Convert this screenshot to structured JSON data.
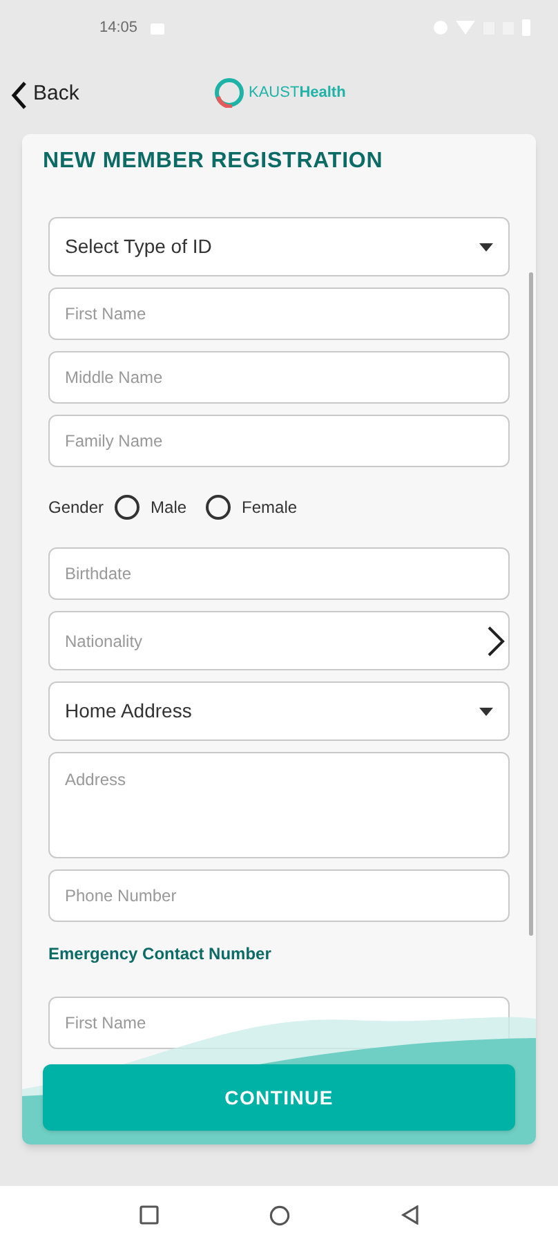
{
  "status_bar": {
    "time": "14:05"
  },
  "header": {
    "back": "Back",
    "logo": "KAUST**Health**"
  },
  "form": {
    "title": "NEW MEMBER REGISTRATION",
    "items": [
      {
        "kind": "select",
        "text": "Select Type of ID"
      },
      {
        "kind": "input",
        "placeholder": "First Name"
      },
      {
        "kind": "input",
        "placeholder": "Middle Name"
      },
      {
        "kind": "input",
        "placeholder": "Family Name"
      },
      {
        "kind": "radio",
        "label": "Gender",
        "options": [
          {
            "label": "Male",
            "selected": false
          },
          {
            "label": "Female",
            "selected": false
          }
        ]
      },
      {
        "kind": "input",
        "placeholder": "Birthdate"
      },
      {
        "kind": "link",
        "placeholder": "Nationality"
      },
      {
        "kind": "select",
        "text": "Home Address"
      },
      {
        "kind": "textarea",
        "placeholder": "Address"
      },
      {
        "kind": "input",
        "placeholder": "Phone Number"
      },
      {
        "kind": "heading",
        "text": "Emergency Contact Number"
      },
      {
        "kind": "input",
        "placeholder": "First Name"
      }
    ]
  },
  "continue_button": "CONTINUE"
}
